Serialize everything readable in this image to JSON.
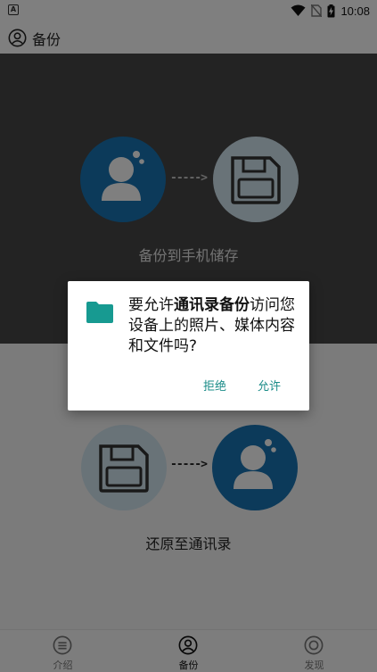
{
  "status_bar": {
    "notification_icon_letter": "A",
    "time": "10:08",
    "icons": [
      "wifi-icon",
      "no-sim-icon",
      "battery-charging-icon"
    ]
  },
  "app_bar": {
    "title": "备份",
    "icon": "account-circle-icon"
  },
  "backup_section": {
    "caption": "备份到手机储存",
    "arrow": "----->"
  },
  "restore_section": {
    "caption": "还原至通讯录",
    "arrow": "----->"
  },
  "bottom_nav": {
    "items": [
      {
        "label": "介绍",
        "icon": "menu-circle-icon",
        "active": false
      },
      {
        "label": "备份",
        "icon": "account-circle-icon",
        "active": true
      },
      {
        "label": "发现",
        "icon": "target-circle-icon",
        "active": false
      }
    ]
  },
  "permission_dialog": {
    "message_prefix": "要允许",
    "app_name": "通讯录备份",
    "message_suffix": "访问您设备上的照片、媒体内容和文件吗?",
    "icon": "folder-icon",
    "deny_label": "拒绝",
    "allow_label": "允许"
  },
  "colors": {
    "accent_blue": "#1874b4",
    "pale_blue": "#d3e6f1",
    "dialog_button": "#1a8c88",
    "folder": "#179a91"
  }
}
